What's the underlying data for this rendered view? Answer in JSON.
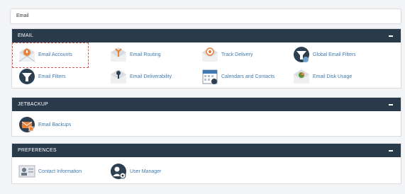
{
  "search": {
    "value": "Email"
  },
  "sections": {
    "email": {
      "title": "EMAIL",
      "items": [
        {
          "label": "Email Accounts",
          "icon": "email-accounts-icon"
        },
        {
          "label": "Email Routing",
          "icon": "email-routing-icon"
        },
        {
          "label": "Track Delivery",
          "icon": "track-delivery-icon"
        },
        {
          "label": "Global Email Filters",
          "icon": "global-email-filters-icon"
        },
        {
          "label": "Email Filters",
          "icon": "email-filters-icon"
        },
        {
          "label": "Email Deliverability",
          "icon": "email-deliverability-icon"
        },
        {
          "label": "Calendars and Contacts",
          "icon": "calendar-icon"
        },
        {
          "label": "Email Disk Usage",
          "icon": "disk-usage-icon"
        }
      ]
    },
    "jetbackup": {
      "title": "JETBACKUP",
      "items": [
        {
          "label": "Email Backups",
          "icon": "email-backups-icon"
        }
      ]
    },
    "preferences": {
      "title": "PREFERENCES",
      "items": [
        {
          "label": "Contact Information",
          "icon": "contact-card-icon"
        },
        {
          "label": "User Manager",
          "icon": "user-manager-icon"
        }
      ]
    }
  },
  "colors": {
    "header_bg": "#293a4a",
    "link": "#3f79b0",
    "accent_orange": "#e8823a",
    "selection_border": "#d9534f"
  }
}
